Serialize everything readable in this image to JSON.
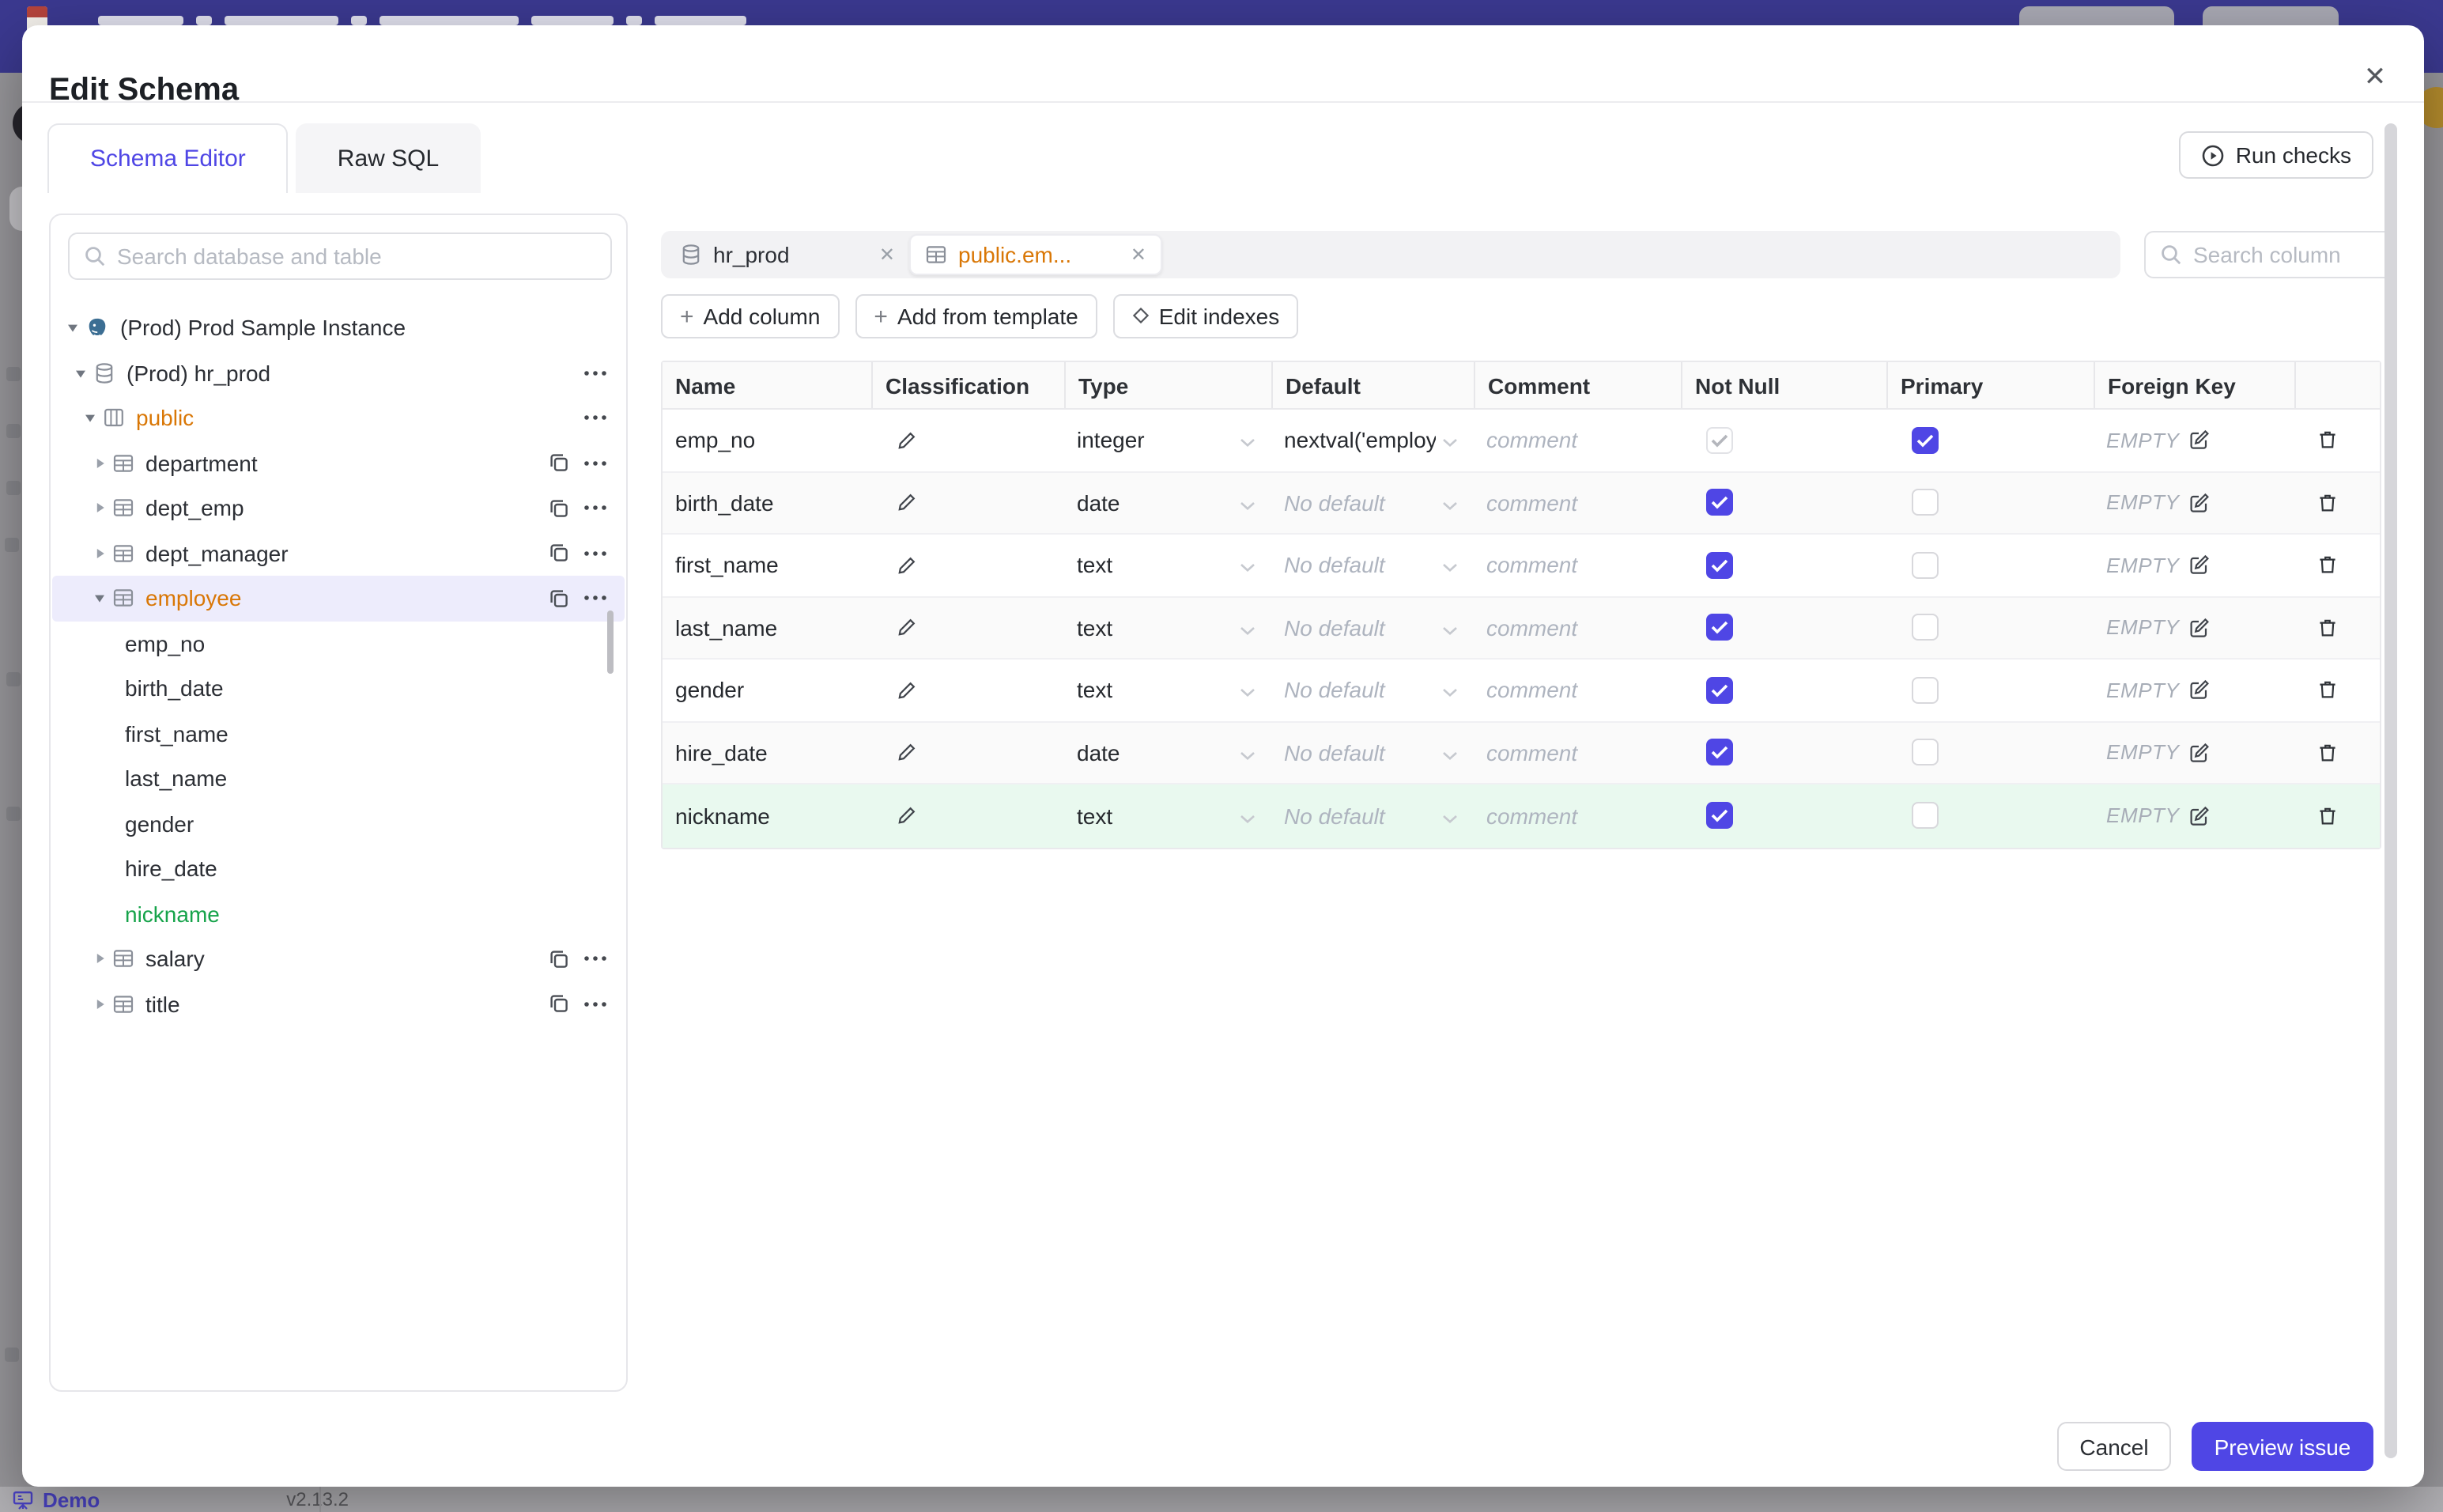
{
  "colors": {
    "accent": "#4f46e5",
    "amber": "#d97706",
    "green": "#16a34a",
    "added_row_bg": "#e9f9ef",
    "topbar": "#3b3990"
  },
  "backdrop": {
    "footer": {
      "brand": "Demo",
      "version": "v2.13.2"
    }
  },
  "dialog": {
    "title": "Edit Schema",
    "tabs": [
      {
        "label": "Schema Editor",
        "active": true
      },
      {
        "label": "Raw SQL",
        "active": false
      }
    ],
    "run_checks_label": "Run checks",
    "sidebar": {
      "search_placeholder": "Search database and table",
      "tree": [
        {
          "label": "(Prod) Prod Sample Instance",
          "level": 0,
          "icon": "postgres",
          "caret": "down"
        },
        {
          "label": "(Prod) hr_prod",
          "level": 1,
          "icon": "database",
          "caret": "down",
          "menu": true
        },
        {
          "label": "public",
          "level": 2,
          "icon": "schema",
          "caret": "down",
          "color": "amber",
          "menu": true
        },
        {
          "label": "department",
          "level": 3,
          "icon": "table",
          "caret": "right",
          "copy": true,
          "menu": true
        },
        {
          "label": "dept_emp",
          "level": 3,
          "icon": "table",
          "caret": "right",
          "copy": true,
          "menu": true
        },
        {
          "label": "dept_manager",
          "level": 3,
          "icon": "table",
          "caret": "right",
          "copy": true,
          "menu": true
        },
        {
          "label": "employee",
          "level": 3,
          "icon": "table",
          "caret": "down",
          "color": "amber",
          "selected": true,
          "copy": true,
          "menu": true
        },
        {
          "label": "emp_no",
          "level": 4,
          "column": true
        },
        {
          "label": "birth_date",
          "level": 4,
          "column": true
        },
        {
          "label": "first_name",
          "level": 4,
          "column": true
        },
        {
          "label": "last_name",
          "level": 4,
          "column": true
        },
        {
          "label": "gender",
          "level": 4,
          "column": true
        },
        {
          "label": "hire_date",
          "level": 4,
          "column": true
        },
        {
          "label": "nickname",
          "level": 4,
          "column": true,
          "color": "green"
        },
        {
          "label": "salary",
          "level": 3,
          "icon": "table",
          "caret": "right",
          "copy": true,
          "menu": true
        },
        {
          "label": "title",
          "level": 3,
          "icon": "table",
          "caret": "right",
          "copy": true,
          "menu": true
        }
      ]
    },
    "editor": {
      "chips": [
        {
          "label": "hr_prod",
          "icon": "database",
          "active": false
        },
        {
          "label": "public.em...",
          "icon": "table",
          "active": true
        }
      ],
      "column_search_placeholder": "Search column",
      "actions": [
        {
          "label": "Add column",
          "icon": "plus"
        },
        {
          "label": "Add from template",
          "icon": "plus"
        },
        {
          "label": "Edit indexes",
          "icon": "diamond"
        }
      ],
      "table": {
        "headers": [
          "Name",
          "Classification",
          "Type",
          "Default",
          "Comment",
          "Not Null",
          "Primary",
          "Foreign Key",
          ""
        ],
        "comment_placeholder": "comment",
        "foreign_key_empty": "EMPTY",
        "rows": [
          {
            "name": "emp_no",
            "type": "integer",
            "default": "nextval('employ",
            "default_is_placeholder": false,
            "not_null": true,
            "not_null_disabled": true,
            "primary": true,
            "state": "normal"
          },
          {
            "name": "birth_date",
            "type": "date",
            "default": "No default",
            "default_is_placeholder": true,
            "not_null": true,
            "not_null_disabled": false,
            "primary": false,
            "state": "normal"
          },
          {
            "name": "first_name",
            "type": "text",
            "default": "No default",
            "default_is_placeholder": true,
            "not_null": true,
            "not_null_disabled": false,
            "primary": false,
            "state": "normal"
          },
          {
            "name": "last_name",
            "type": "text",
            "default": "No default",
            "default_is_placeholder": true,
            "not_null": true,
            "not_null_disabled": false,
            "primary": false,
            "state": "normal"
          },
          {
            "name": "gender",
            "type": "text",
            "default": "No default",
            "default_is_placeholder": true,
            "not_null": true,
            "not_null_disabled": false,
            "primary": false,
            "state": "normal"
          },
          {
            "name": "hire_date",
            "type": "date",
            "default": "No default",
            "default_is_placeholder": true,
            "not_null": true,
            "not_null_disabled": false,
            "primary": false,
            "state": "normal"
          },
          {
            "name": "nickname",
            "type": "text",
            "default": "No default",
            "default_is_placeholder": true,
            "not_null": true,
            "not_null_disabled": false,
            "primary": false,
            "state": "added"
          }
        ]
      }
    },
    "footer_buttons": {
      "cancel": "Cancel",
      "primary": "Preview issue"
    }
  }
}
